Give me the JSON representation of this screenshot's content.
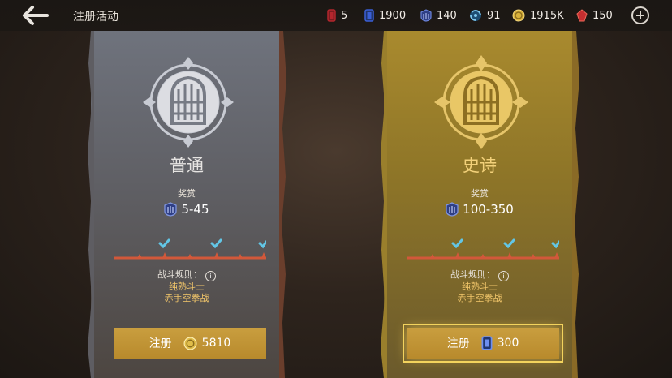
{
  "header": {
    "title": "注册活动"
  },
  "resources": [
    {
      "name": "red-card",
      "value": "5",
      "color": "#b2262d"
    },
    {
      "name": "blue-card",
      "value": "1900",
      "color": "#3a5fd6"
    },
    {
      "name": "shield-token",
      "value": "140",
      "color": "#4d66c4"
    },
    {
      "name": "swirl-orb",
      "value": "91",
      "color": "#4aa0d6"
    },
    {
      "name": "gold-coin",
      "value": "1915K",
      "color": "#d8b13a"
    },
    {
      "name": "red-gem",
      "value": "150",
      "color": "#d8383a"
    }
  ],
  "cards": [
    {
      "tier": "普通",
      "reward_label": "奖赏",
      "reward": "5-45",
      "rules_label": "战斗规则：",
      "info_icon": "i",
      "rule1": "纯熟斗士",
      "rule2": "赤手空拳战",
      "button_label": "注册",
      "cost": "5810",
      "cost_icon": "gold-coin"
    },
    {
      "tier": "史诗",
      "reward_label": "奖赏",
      "reward": "100-350",
      "rules_label": "战斗规则：",
      "info_icon": "i",
      "rule1": "纯熟斗士",
      "rule2": "赤手空拳战",
      "button_label": "注册",
      "cost": "300",
      "cost_icon": "blue-card"
    }
  ]
}
